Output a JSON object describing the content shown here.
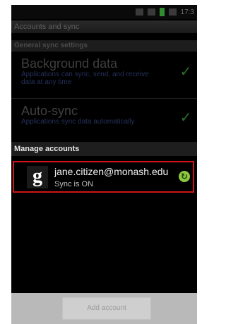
{
  "status_bar": {
    "time": "17:3"
  },
  "screen_title": "Accounts and sync",
  "general": {
    "header": "General sync settings",
    "items": [
      {
        "title": "Background data",
        "description": "Applications can sync, send, and receive data at any time",
        "checked": true
      },
      {
        "title": "Auto-sync",
        "description": "Applications sync data automatically",
        "checked": true
      }
    ]
  },
  "manage": {
    "header": "Manage accounts",
    "account": {
      "logo_letter": "g",
      "email": "jane.citizen@monash.edu",
      "status": "Sync is ON",
      "sync_icon": "sync-icon"
    }
  },
  "footer": {
    "add_account_label": "Add account"
  },
  "colors": {
    "highlight_border": "#d1141c",
    "sync_green": "#8dc63f",
    "checkbox_green": "#2d6d2d"
  }
}
